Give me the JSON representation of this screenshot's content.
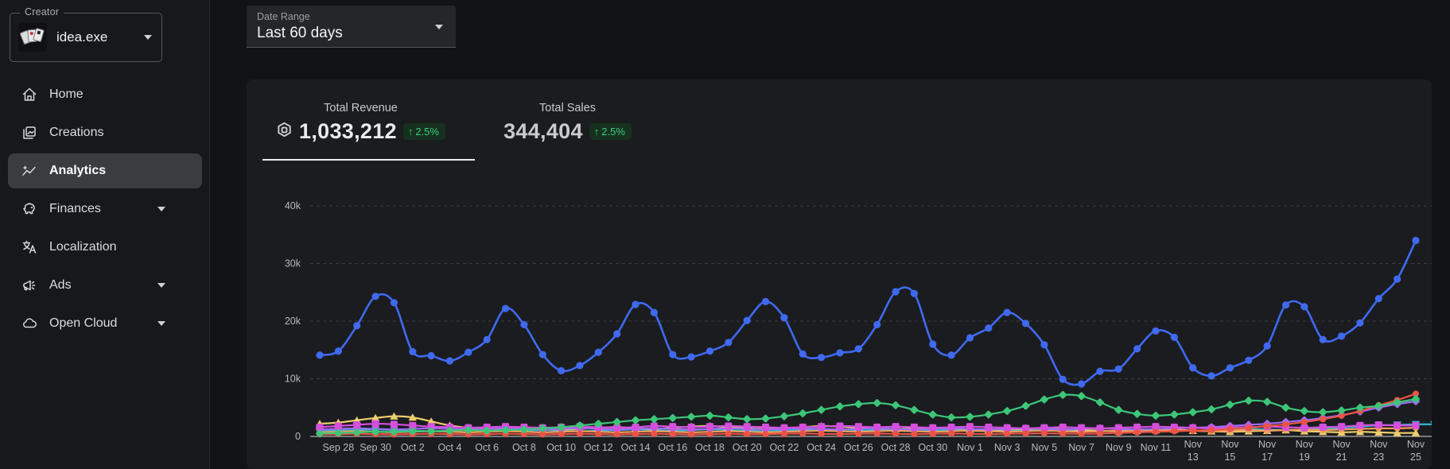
{
  "sidebar": {
    "creator_label": "Creator",
    "creator_name": "idea.exe",
    "items": [
      {
        "label": "Home",
        "icon": "home-icon",
        "expandable": false,
        "active": false
      },
      {
        "label": "Creations",
        "icon": "creations-icon",
        "expandable": false,
        "active": false
      },
      {
        "label": "Analytics",
        "icon": "analytics-icon",
        "expandable": false,
        "active": true
      },
      {
        "label": "Finances",
        "icon": "finances-icon",
        "expandable": true,
        "active": false
      },
      {
        "label": "Localization",
        "icon": "localization-icon",
        "expandable": false,
        "active": false
      },
      {
        "label": "Ads",
        "icon": "ads-icon",
        "expandable": true,
        "active": false
      },
      {
        "label": "Open Cloud",
        "icon": "open-cloud-icon",
        "expandable": true,
        "active": false
      }
    ]
  },
  "header": {
    "date_range_label": "Date Range",
    "date_range_value": "Last 60 days"
  },
  "stats": [
    {
      "label": "Total Revenue",
      "value": "1,033,212",
      "delta": "2.5%",
      "delta_arrow": "↑",
      "has_robux_icon": true,
      "active": true
    },
    {
      "label": "Total Sales",
      "value": "344,404",
      "delta": "2.5%",
      "delta_arrow": "↑",
      "has_robux_icon": false,
      "active": false
    }
  ],
  "colors": {
    "accent_green": "#3ed17d",
    "badge_bg": "#16311f",
    "panel_bg": "#1b1c1f",
    "sidebar_bg": "#17181b"
  },
  "chart_data": {
    "type": "line",
    "title": "",
    "xlabel": "",
    "ylabel": "",
    "ylim": [
      0,
      40000
    ],
    "grid": "horizontal-dashed",
    "legend_position": "none",
    "x_period_days": 60,
    "y_ticks": [
      {
        "label": "0",
        "value": 0
      },
      {
        "label": "10k",
        "value": 10000
      },
      {
        "label": "20k",
        "value": 20000
      },
      {
        "label": "30k",
        "value": 30000
      },
      {
        "label": "40k",
        "value": 40000
      }
    ],
    "x_tick_labels": [
      "Sep 28",
      "Sep 30",
      "Oct 2",
      "Oct 4",
      "Oct 6",
      "Oct 8",
      "Oct 10",
      "Oct 12",
      "Oct 14",
      "Oct 16",
      "Oct 18",
      "Oct 20",
      "Oct 22",
      "Oct 24",
      "Oct 26",
      "Oct 28",
      "Oct 30",
      "Nov 1",
      "Nov 3",
      "Nov 5",
      "Nov 7",
      "Nov 9",
      "Nov 11",
      "Nov 13",
      "Nov 15",
      "Nov 17",
      "Nov 19",
      "Nov 21",
      "Nov 23",
      "Nov 25"
    ],
    "x_tick_wrap_from_index": 23,
    "series": [
      {
        "name": "cyan",
        "color": "#2cb9d4",
        "marker": "triangle-down",
        "values": [
          900,
          1000,
          1100,
          1200,
          1100,
          1000,
          900,
          1000,
          1100,
          1000,
          900,
          1000,
          1100,
          1000,
          900,
          1000,
          1100,
          1200,
          1100,
          1000,
          1100,
          1200,
          1100,
          1000,
          900,
          1000,
          1100,
          1000,
          900,
          1000,
          1100,
          1000,
          900,
          1000,
          1100,
          1000,
          900,
          1000,
          1100,
          1200,
          1100,
          1000,
          900,
          1000,
          1100,
          1200,
          1100,
          1000,
          1100,
          1200,
          1300,
          1200,
          1100,
          1200,
          1400,
          1500,
          1700,
          1900,
          2000,
          2100,
          2100
        ]
      },
      {
        "name": "yellow",
        "color": "#eccf6d",
        "marker": "triangle-up",
        "values": [
          2200,
          2400,
          2800,
          3200,
          3500,
          3300,
          2600,
          1900,
          1500,
          1300,
          1400,
          1500,
          1300,
          1200,
          1300,
          1500,
          1600,
          1400,
          1300,
          1500,
          1700,
          1800,
          1600,
          1400,
          1300,
          1400,
          1600,
          1800,
          1700,
          1500,
          1400,
          1300,
          1400,
          1500,
          1400,
          1200,
          1100,
          1200,
          1300,
          1400,
          1300,
          1100,
          1000,
          900,
          1000,
          1100,
          1200,
          1000,
          900,
          800,
          900,
          1000,
          1100,
          900,
          800,
          700,
          800,
          700,
          600,
          600
        ]
      },
      {
        "name": "orange",
        "color": "#f29b5a",
        "marker": "circle",
        "values": [
          700,
          800,
          900,
          800,
          700,
          800,
          900,
          800,
          700,
          800,
          900,
          800,
          700,
          800,
          900,
          800,
          700,
          800,
          900,
          800,
          700,
          800,
          900,
          800,
          700,
          800,
          900,
          1000,
          900,
          800,
          900,
          1000,
          900,
          800,
          900,
          1000,
          900,
          800,
          900,
          1000,
          900,
          800,
          900,
          1000,
          900,
          1000,
          1100,
          1000,
          900,
          1000,
          1100,
          1000,
          1100,
          1200,
          1100,
          1200,
          1300,
          1400,
          1400,
          1500
        ]
      },
      {
        "name": "violet",
        "color": "#9b6df2",
        "marker": "diamond",
        "values": [
          1200,
          1300,
          1400,
          1300,
          1200,
          1300,
          1400,
          1300,
          1200,
          1300,
          1400,
          1300,
          1200,
          1300,
          1400,
          1300,
          1200,
          1300,
          1400,
          1300,
          1200,
          1300,
          1400,
          1300,
          1200,
          1300,
          1400,
          1300,
          1200,
          1300,
          1400,
          1300,
          1200,
          1300,
          1400,
          1300,
          1200,
          1300,
          1400,
          1300,
          1200,
          1300,
          1400,
          1300,
          1200,
          1300,
          1400,
          1500,
          1600,
          1800,
          2000,
          2200,
          2500,
          2800,
          3200,
          3700,
          4300,
          5000,
          5600,
          6100
        ]
      },
      {
        "name": "magenta",
        "color": "#d44fdd",
        "marker": "square",
        "values": [
          1600,
          1800,
          2000,
          2200,
          2100,
          1900,
          1700,
          1600,
          1500,
          1600,
          1700,
          1600,
          1500,
          1600,
          1700,
          1600,
          1500,
          1600,
          1800,
          1700,
          1600,
          1700,
          1800,
          1700,
          1600,
          1500,
          1600,
          1700,
          1800,
          1700,
          1600,
          1700,
          1600,
          1500,
          1600,
          1700,
          1600,
          1500,
          1400,
          1500,
          1600,
          1500,
          1400,
          1500,
          1600,
          1700,
          1600,
          1500,
          1400,
          1500,
          1600,
          1700,
          1600,
          1500,
          1600,
          1700,
          1900,
          2000,
          1900,
          1900
        ]
      },
      {
        "name": "red",
        "color": "#eb5345",
        "marker": "circle",
        "values": [
          350,
          400,
          450,
          400,
          350,
          400,
          450,
          400,
          350,
          400,
          450,
          400,
          350,
          400,
          450,
          400,
          350,
          400,
          450,
          400,
          350,
          400,
          450,
          400,
          400,
          450,
          500,
          450,
          400,
          450,
          500,
          450,
          400,
          450,
          500,
          450,
          400,
          450,
          500,
          550,
          500,
          450,
          500,
          600,
          700,
          800,
          900,
          1000,
          1100,
          1300,
          1500,
          1800,
          2100,
          2500,
          3000,
          3600,
          4400,
          5400,
          6300,
          7400
        ]
      },
      {
        "name": "green",
        "color": "#3cc678",
        "marker": "diamond",
        "values": [
          500,
          600,
          700,
          800,
          800,
          900,
          900,
          1000,
          1100,
          1000,
          1100,
          1200,
          1400,
          1600,
          1900,
          2200,
          2500,
          2800,
          3000,
          3200,
          3400,
          3600,
          3300,
          3000,
          3100,
          3500,
          4000,
          4600,
          5200,
          5600,
          5800,
          5400,
          4600,
          3800,
          3300,
          3400,
          3800,
          4400,
          5300,
          6400,
          7200,
          7000,
          5900,
          4600,
          3900,
          3600,
          3800,
          4200,
          4700,
          5500,
          6200,
          6000,
          5000,
          4400,
          4200,
          4500,
          5000,
          5300,
          5900,
          6500
        ]
      },
      {
        "name": "blue",
        "color": "#3f6af0",
        "marker": "circle",
        "values": [
          14100,
          14800,
          19200,
          24300,
          23200,
          14700,
          14000,
          13100,
          14600,
          16800,
          22200,
          19400,
          14200,
          11400,
          12300,
          14600,
          17800,
          22900,
          21500,
          14200,
          13800,
          14800,
          16300,
          20100,
          23400,
          20600,
          14300,
          13700,
          14500,
          15200,
          19400,
          25100,
          24800,
          16000,
          14100,
          17100,
          18800,
          21500,
          19600,
          15900,
          9900,
          9100,
          11300,
          11700,
          15200,
          18300,
          17200,
          11900,
          10500,
          11900,
          13200,
          15700,
          22800,
          22500,
          16800,
          17400,
          19700,
          23900,
          27300,
          34000
        ]
      }
    ]
  }
}
